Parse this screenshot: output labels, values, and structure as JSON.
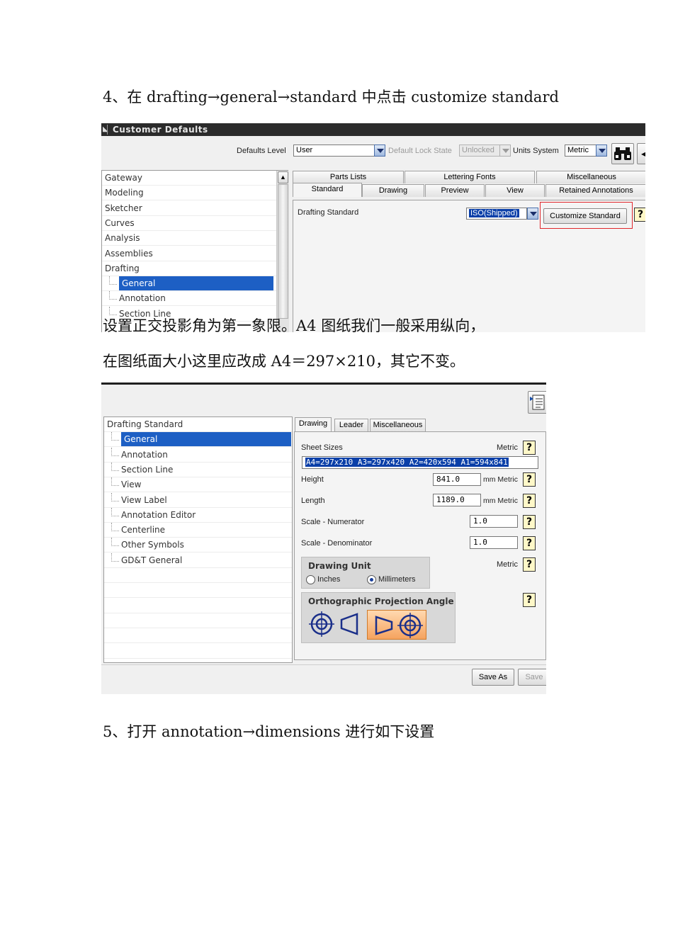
{
  "doc": {
    "step4": "4、在 drafting→general→standard 中点击 customize standard",
    "para1": "设置正交投影角为第一象限。A4 图纸我们一般采用纵向，",
    "para2": "在图纸面大小这里应改成 A4＝297×210，其它不变。",
    "step5": "5、打开 annotation→dimensions 进行如下设置"
  },
  "shot1": {
    "title": "Customer Defaults",
    "defaults_level_label": "Defaults Level",
    "defaults_level_value": "User",
    "lock_state_label": "Default Lock State",
    "lock_state_value": "Unlocked",
    "units_system_label": "Units System",
    "units_system_value": "Metric",
    "tree": [
      "Gateway",
      "Modeling",
      "Sketcher",
      "Curves",
      "Analysis",
      "Assemblies",
      "Drafting",
      "General",
      "Annotation",
      "Section Line"
    ],
    "tabs_top": [
      "Parts Lists",
      "Lettering Fonts",
      "Miscellaneous"
    ],
    "tabs_bottom": [
      "Standard",
      "Drawing",
      "Preview",
      "View",
      "Retained Annotations"
    ],
    "drafting_standard_label": "Drafting Standard",
    "drafting_standard_value": "ISO(Shipped)",
    "customize_button": "Customize Standard",
    "highlight_color": "#e0262b"
  },
  "shot2": {
    "tree": [
      "Drafting Standard",
      "General",
      "Annotation",
      "Section Line",
      "View",
      "View Label",
      "Annotation Editor",
      "Centerline",
      "Other Symbols",
      "GD&T General"
    ],
    "tabs": [
      "Drawing",
      "Leader",
      "Miscellaneous"
    ],
    "sheet_sizes_label": "Sheet Sizes",
    "metric": "Metric",
    "sheet_sizes_value": "A4=297x210  A3=297x420  A2=420x594  A1=594x841",
    "height_label": "Height",
    "height_value": "841.0",
    "length_label": "Length",
    "length_value": "1189.0",
    "mm_metric": "mm Metric",
    "scale_num_label": "Scale - Numerator",
    "scale_num_value": "1.0",
    "scale_den_label": "Scale - Denominator",
    "scale_den_value": "1.0",
    "drawing_unit_title": "Drawing Unit",
    "inches": "Inches",
    "millimeters": "Millimeters",
    "projection_title": "Orthographic Projection Angle",
    "save_as": "Save As",
    "save": "Save",
    "help_glyph": "?"
  }
}
